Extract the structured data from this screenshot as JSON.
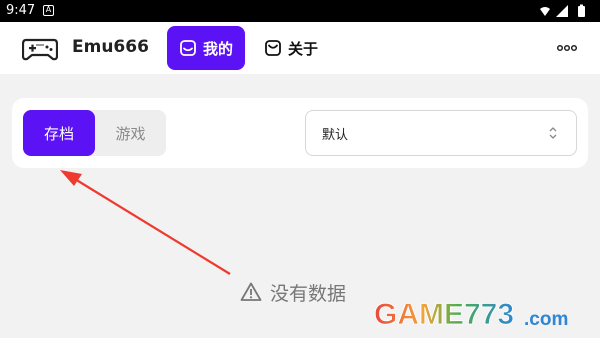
{
  "status_bar": {
    "time": "9:47",
    "notification_glyph": "A",
    "icons": [
      "wifi-icon",
      "signal-icon",
      "battery-icon"
    ]
  },
  "header": {
    "app_title": "Emu666",
    "logo_icon": "gamepad-icon",
    "tabs": [
      {
        "label": "我的",
        "icon": "inbox-icon",
        "active": true
      },
      {
        "label": "关于",
        "icon": "about-icon",
        "active": false
      }
    ],
    "more_icon": "more-dots-icon"
  },
  "filter_bar": {
    "segments": [
      {
        "label": "存档",
        "active": true
      },
      {
        "label": "游戏",
        "active": false
      }
    ],
    "select": {
      "value": "默认"
    }
  },
  "empty_state": {
    "icon": "warning-icon",
    "text": "没有数据"
  },
  "watermark": {
    "text": "GAME773",
    "suffix": ".com"
  },
  "colors": {
    "accent": "#5b12f5",
    "annotation_arrow": "#ee3b2f",
    "background": "#f2f2f2"
  }
}
